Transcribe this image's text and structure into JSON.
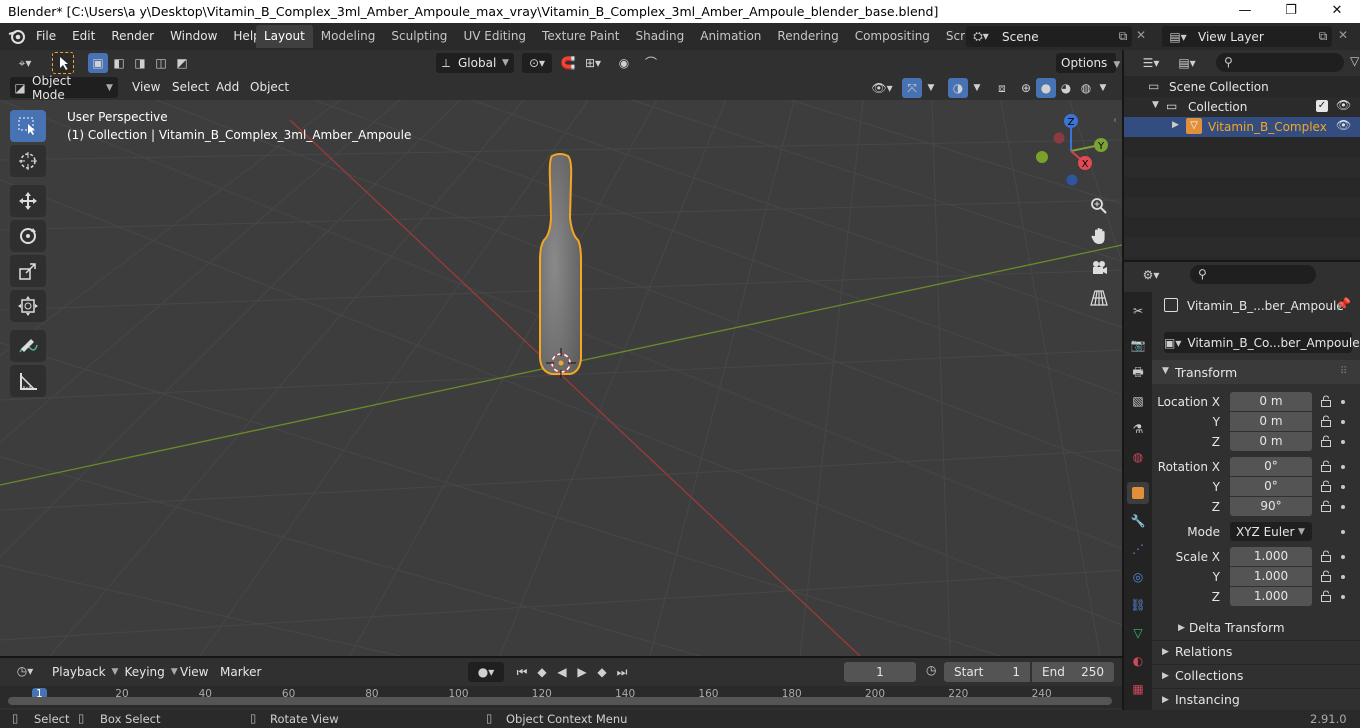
{
  "window": {
    "title": "Blender* [C:\\Users\\a y\\Desktop\\Vitamin_B_Complex_3ml_Amber_Ampoule_max_vray\\Vitamin_B_Complex_3ml_Amber_Ampoule_blender_base.blend]",
    "minimize": "—",
    "maximize": "❐",
    "close": "✕"
  },
  "menus": [
    "File",
    "Edit",
    "Render",
    "Window",
    "Help"
  ],
  "workspaces": [
    "Layout",
    "Modeling",
    "Sculpting",
    "UV Editing",
    "Texture Paint",
    "Shading",
    "Animation",
    "Rendering",
    "Compositing",
    "Scripting"
  ],
  "active_workspace": "Layout",
  "scene": {
    "name": "Scene",
    "view_layer": "View Layer"
  },
  "header": {
    "orientation": "Global",
    "options": "Options",
    "mode": "Object Mode",
    "menu_view": "View",
    "menu_select": "Select",
    "menu_add": "Add",
    "menu_object": "Object"
  },
  "viewport": {
    "perspective": "User Perspective",
    "collection_info": "(1) Collection | Vitamin_B_Complex_3ml_Amber_Ampoule",
    "gizmo_x": "X",
    "gizmo_y": "Y",
    "gizmo_z": "Z"
  },
  "outliner": {
    "scene_collection": "Scene Collection",
    "collection": "Collection",
    "object": "Vitamin_B_Complex"
  },
  "properties": {
    "object_name": "Vitamin_B_...ber_Ampoule",
    "datablock": "Vitamin_B_Co...ber_Ampoule",
    "transform": "Transform",
    "location_label": "Location X",
    "rotation_label": "Rotation X",
    "scale_label": "Scale X",
    "y_label": "Y",
    "z_label": "Z",
    "mode_label": "Mode",
    "location": [
      "0 m",
      "0 m",
      "0 m"
    ],
    "rotation": [
      "0°",
      "0°",
      "90°"
    ],
    "rotation_mode": "XYZ Euler",
    "scale": [
      "1.000",
      "1.000",
      "1.000"
    ],
    "delta_transform": "Delta Transform",
    "relations": "Relations",
    "collections": "Collections",
    "instancing": "Instancing"
  },
  "timeline": {
    "playback": "Playback",
    "keying": "Keying",
    "view": "View",
    "marker": "Marker",
    "current_frame": "1",
    "start_label": "Start",
    "start": "1",
    "end_label": "End",
    "end": "250",
    "ruler": [
      "1",
      "20",
      "40",
      "60",
      "80",
      "100",
      "120",
      "140",
      "160",
      "180",
      "200",
      "220",
      "240"
    ]
  },
  "status": {
    "select": "Select",
    "box_select": "Box Select",
    "rotate_view": "Rotate View",
    "context_menu": "Object Context Menu",
    "version": "2.91.0"
  },
  "colors": {
    "accent": "#4772b3",
    "selection_outline": "#f5a623",
    "x_axis": "#9b3a3a",
    "y_axis": "#6a8a2a"
  }
}
